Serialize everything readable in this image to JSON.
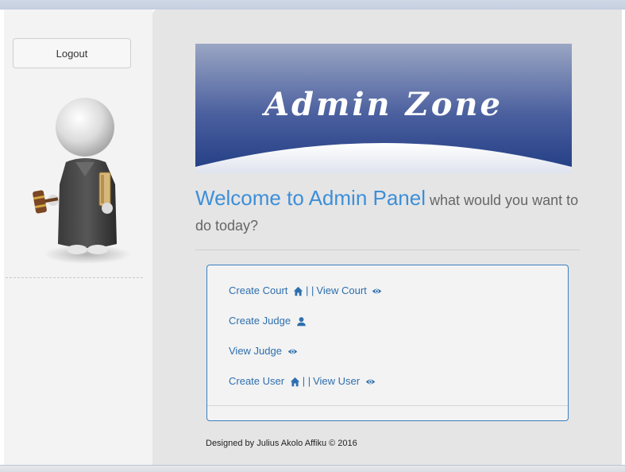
{
  "sidebar": {
    "logout_label": "Logout"
  },
  "banner": {
    "title": "Admin Zone"
  },
  "welcome": {
    "heading": "Welcome to Admin Panel",
    "subtext": " what would you want to do today?"
  },
  "menu": {
    "create_court": "Create Court",
    "view_court": "View Court",
    "create_judge": "Create Judge",
    "view_judge": "View Judge",
    "create_user": "Create User",
    "view_user": "View User",
    "separator": "| |"
  },
  "footer": {
    "text": "Designed by Julius Akolo Affiku © 2016"
  },
  "colors": {
    "link": "#2e6fae",
    "heading": "#3d8fd8",
    "banner_top": "#9aa6c4",
    "banner_bottom": "#223d84",
    "panel_border": "#3a7fc1"
  },
  "icons": [
    "home-icon",
    "eye-icon",
    "user-icon"
  ]
}
